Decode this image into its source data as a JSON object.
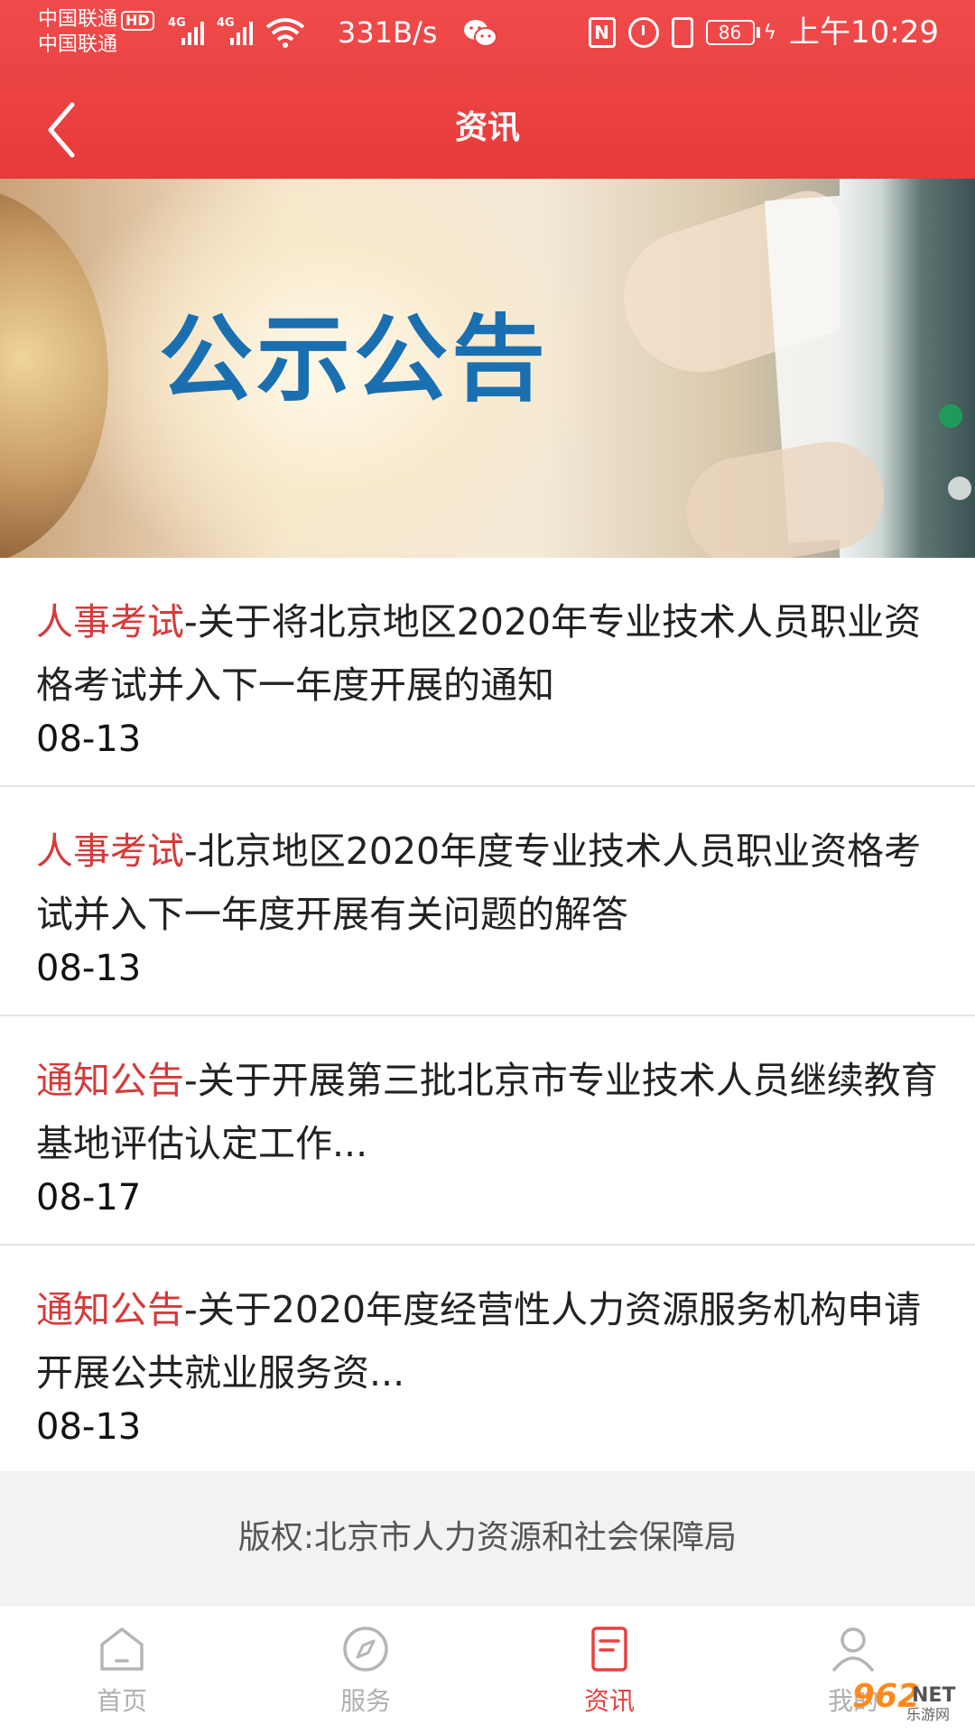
{
  "status_bar": {
    "carrier_1": "中国联通",
    "carrier_badge": "HD",
    "carrier_2": "中国联通",
    "signal_1_tag": "4G",
    "signal_2_tag": "4G",
    "net_speed": "331B/s",
    "nfc_label": "N",
    "battery_level": "86",
    "time": "上午10:29"
  },
  "header": {
    "title": "资讯",
    "background_color": "#e84444",
    "back_icon": "chevron-left-icon"
  },
  "banner": {
    "title": "公示公告",
    "title_color": "#1a6fb0"
  },
  "news": [
    {
      "category": "人事考试",
      "title": "-关于将北京地区2020年专业技术人员职业资格考试并入下一年度开展的通知",
      "date": "08-13"
    },
    {
      "category": "人事考试",
      "title": "-北京地区2020年度专业技术人员职业资格考试并入下一年度开展有关问题的解答",
      "date": "08-13"
    },
    {
      "category": "通知公告",
      "title": "-关于开展第三批北京市专业技术人员继续教育基地评估认定工作...",
      "date": "08-17"
    },
    {
      "category": "通知公告",
      "title": "-关于2020年度经营性人力资源服务机构申请开展公共就业服务资...",
      "date": "08-13"
    }
  ],
  "category_color": "#d63a3a",
  "footer": {
    "copyright": "版权:北京市人力资源和社会保障局"
  },
  "tabs": [
    {
      "label": "首页",
      "icon": "home-icon",
      "active": false
    },
    {
      "label": "服务",
      "icon": "compass-icon",
      "active": false
    },
    {
      "label": "资讯",
      "icon": "document-icon",
      "active": true
    },
    {
      "label": "我的",
      "icon": "user-icon",
      "active": false
    }
  ],
  "watermark": {
    "number": "962",
    "net": "NET",
    "sub": "乐游网"
  }
}
